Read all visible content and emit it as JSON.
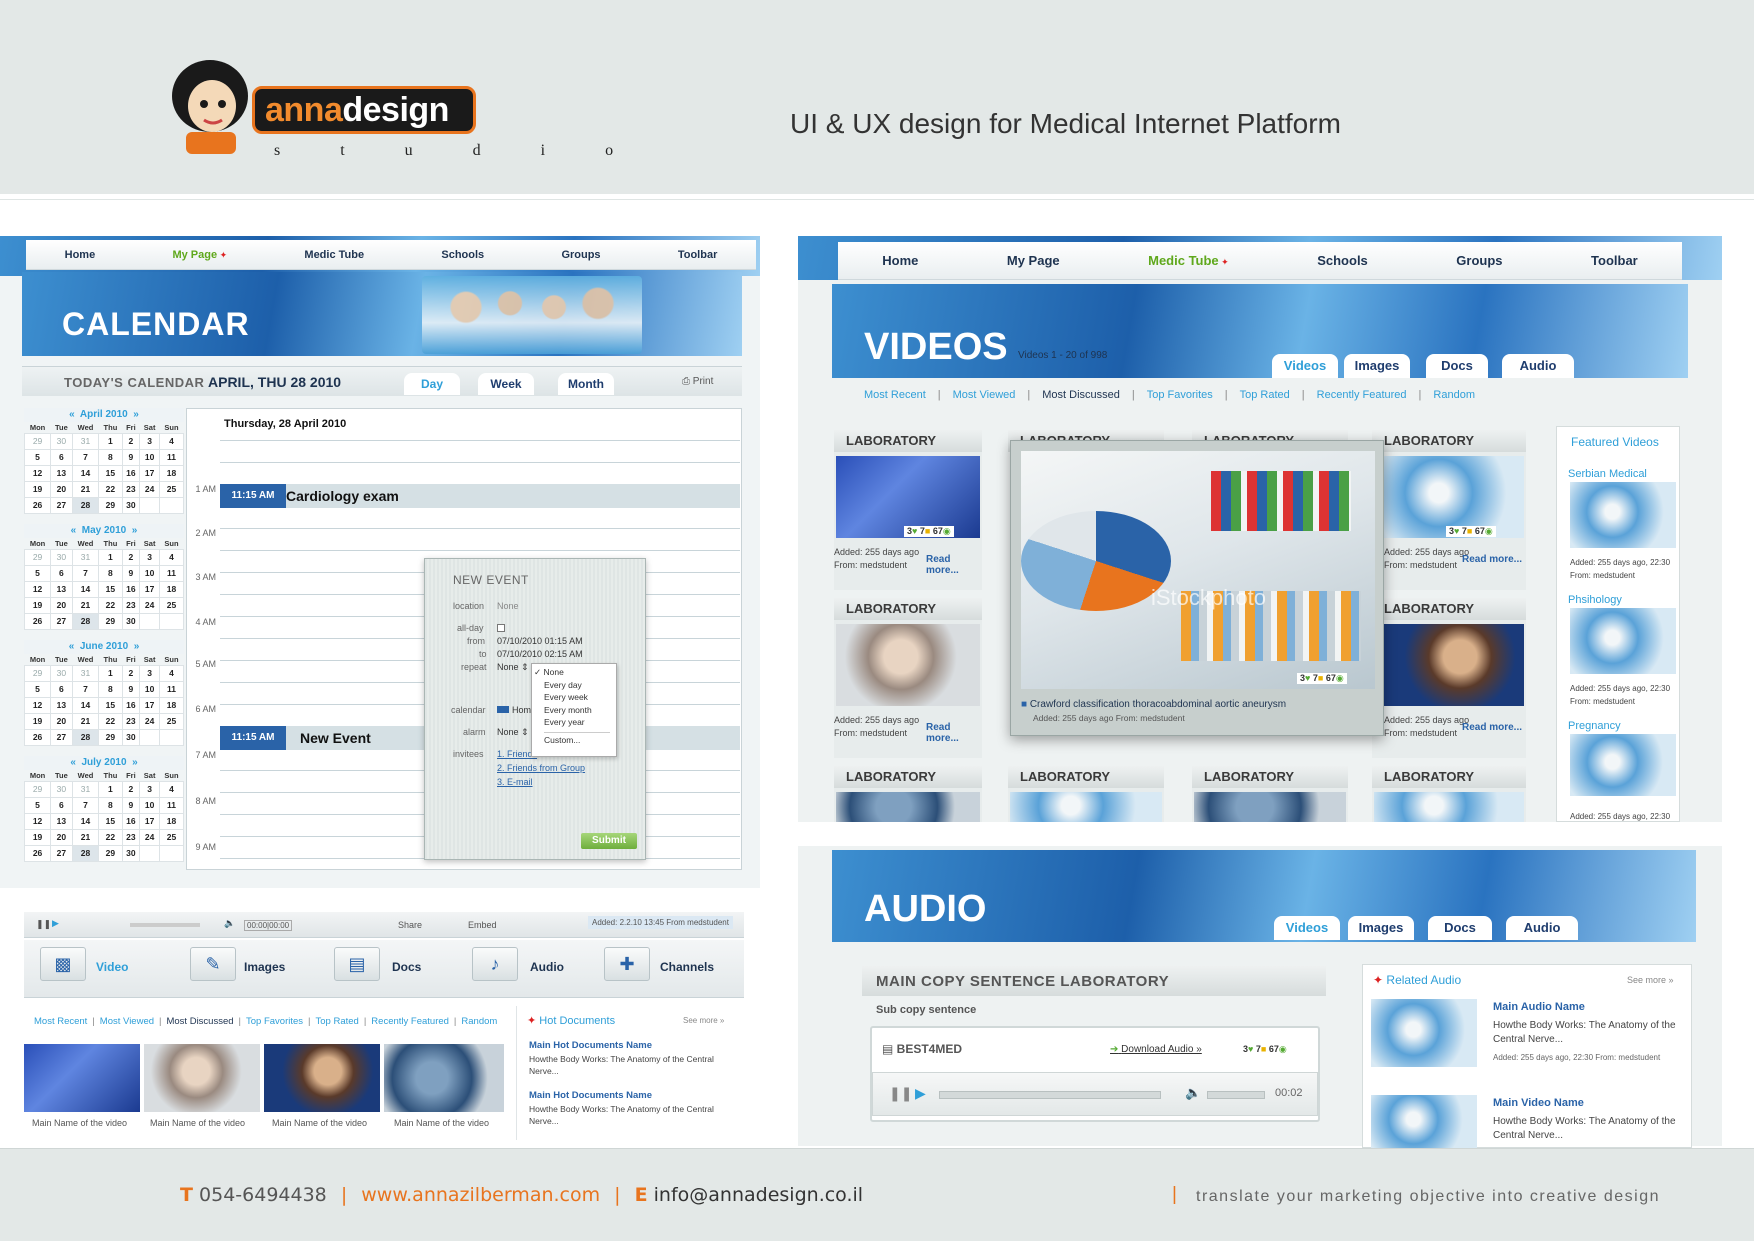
{
  "brand": {
    "name_part1": "anna",
    "name_part2": "design",
    "tagline": "s t u d i o"
  },
  "page_title": "UI & UX design for Medical Internet Platform",
  "footer": {
    "t_label": "T",
    "phone": "054-6494438",
    "sep": "|",
    "website": "www.annazilberman.com",
    "e_label": "E",
    "email": "info@annadesign.co.il",
    "slogan": "translate your marketing objective into creative design"
  },
  "calendar_screen": {
    "nav": [
      "Home",
      "My Page",
      "Medic Tube",
      "Schools",
      "Groups",
      "Toolbar"
    ],
    "banner_title": "CALENDAR",
    "todays_label": "TODAY'S CALENDAR",
    "date": "APRIL, THU 28 2010",
    "views": [
      "Day",
      "Week",
      "Month"
    ],
    "print": "Print",
    "day_heading": "Thursday, 28 April 2010",
    "hours": [
      "1 AM",
      "2 AM",
      "3 AM",
      "4 AM",
      "5 AM",
      "6 AM",
      "7 AM",
      "8 AM",
      "9 AM"
    ],
    "weekdays": [
      "Mon",
      "Tue",
      "Wed",
      "Thu",
      "Fri",
      "Sat",
      "Sun"
    ],
    "months": [
      "April 2010",
      "May 2010",
      "June 2010",
      "July 2010"
    ],
    "month_rows": [
      [
        "29",
        "30",
        "31",
        "1",
        "2",
        "3",
        "4"
      ],
      [
        "5",
        "6",
        "7",
        "8",
        "9",
        "10",
        "11"
      ],
      [
        "12",
        "13",
        "14",
        "15",
        "16",
        "17",
        "18"
      ],
      [
        "19",
        "20",
        "21",
        "22",
        "23",
        "24",
        "25"
      ],
      [
        "26",
        "27",
        "28",
        "29",
        "30",
        "",
        ""
      ]
    ],
    "events": [
      {
        "time": "11:15 AM",
        "title": "Cardiology exam"
      },
      {
        "time": "11:15 AM",
        "title": "New Event"
      }
    ],
    "new_event": {
      "title": "NEW EVENT",
      "location_label": "location",
      "location_value": "None",
      "allday_label": "all-day",
      "from_label": "from",
      "from_value": "07/10/2010 01:15 AM",
      "to_label": "to",
      "to_value": "07/10/2010 02:15 AM",
      "repeat_label": "repeat",
      "repeat_value": "None",
      "repeat_options": [
        "None",
        "Every day",
        "Every week",
        "Every month",
        "Every year",
        "Custom..."
      ],
      "calendar_label": "calendar",
      "calendar_value": "Hom",
      "alarm_label": "alarm",
      "alarm_value": "None",
      "invitees_label": "invitees",
      "invitees": [
        "1. Friends",
        "2. Friends from Group",
        "3. E-mail"
      ],
      "submit": "Submit"
    }
  },
  "media_strip": {
    "player": {
      "time": "00:00|00:00",
      "share": "Share",
      "embed": "Embed",
      "added": "Added: 2.2.10 13:45 From medstudent"
    },
    "buttons": [
      "Video",
      "Images",
      "Docs",
      "Audio",
      "Channels"
    ],
    "filters": [
      "Most Recent",
      "Most Viewed",
      "Most Discussed",
      "Top Favorites",
      "Top Rated",
      "Recently Featured",
      "Random"
    ],
    "video_caption": "Main Name of the video",
    "hot_title": "Hot Documents",
    "see_more": "See more »",
    "hot_items": [
      {
        "title": "Main Hot Documents Name",
        "desc": "Howthe Body Works: The Anatomy of the Central Nerve..."
      },
      {
        "title": "Main Hot Documents Name",
        "desc": "Howthe Body Works: The Anatomy of the Central Nerve..."
      }
    ]
  },
  "videos_screen": {
    "nav": [
      "Home",
      "My Page",
      "Medic Tube",
      "Schools",
      "Groups",
      "Toolbar"
    ],
    "banner_title": "VIDEOS",
    "count": "Videos 1 - 20 of 998",
    "tabs": [
      "Videos",
      "Images",
      "Docs",
      "Audio"
    ],
    "filters": [
      "Most Recent",
      "Most Viewed",
      "Most Discussed",
      "Top Favorites",
      "Top Rated",
      "Recently Featured",
      "Random"
    ],
    "card_label": "LABORATORY",
    "card_added": "Added: 255 days ago",
    "card_from": "From: medstudent",
    "read_more": "Read more...",
    "rating": {
      "likes": "3",
      "favs": "7",
      "views": "67"
    },
    "popup_caption": "Crawford classification thoracoabdominal aortic aneurysm",
    "popup_meta": "Added: 255 days ago From: medstudent",
    "watermark": "iStockphoto",
    "featured_title": "Featured Videos",
    "featured": [
      {
        "name": "Serbian Medical",
        "added": "Added: 255 days ago, 22:30",
        "from": "From: medstudent"
      },
      {
        "name": "Phsihology",
        "added": "Added: 255 days ago, 22:30",
        "from": "From: medstudent"
      },
      {
        "name": "Pregnancy",
        "added": "Added: 255 days ago, 22:30",
        "from": ""
      }
    ]
  },
  "audio_screen": {
    "banner_title": "AUDIO",
    "tabs": [
      "Videos",
      "Images",
      "Docs",
      "Audio"
    ],
    "main_copy": "MAIN COPY SENTENCE LABORATORY",
    "sub_copy": "Sub copy sentence",
    "player_brand": "BEST4MED",
    "download": "Download Audio »",
    "rating": {
      "likes": "3",
      "favs": "7",
      "views": "67"
    },
    "duration": "00:02",
    "related_title": "Related Audio",
    "see_more": "See more »",
    "related": [
      {
        "title": "Main Audio Name",
        "desc": "Howthe Body Works: The Anatomy of the Central Nerve...",
        "meta": "Added: 255 days ago, 22:30 From: medstudent"
      },
      {
        "title": "Main Video Name",
        "desc": "Howthe Body Works: The Anatomy of the Central Nerve...",
        "meta": ""
      }
    ]
  },
  "colors": {
    "accent": "#2f9fd8",
    "brand_orange": "#e8741e",
    "nav_active": "#5fa81c",
    "event_blue": "#2a63a8"
  }
}
